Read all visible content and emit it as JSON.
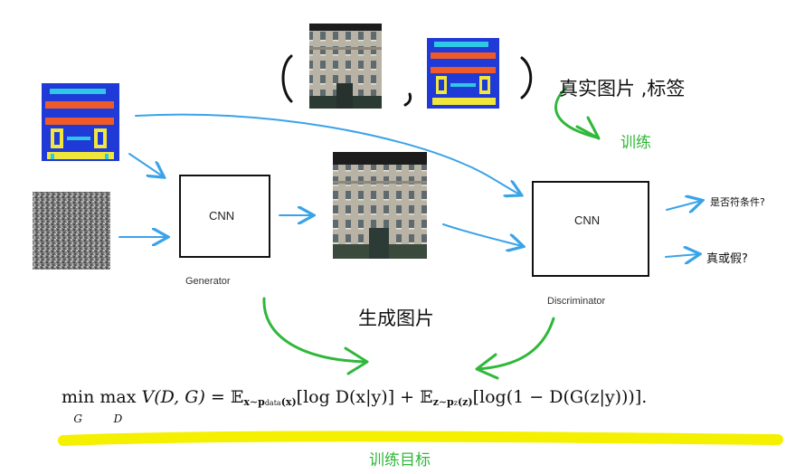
{
  "labels": {
    "generator_box": "CNN",
    "generator_caption": "Generator",
    "discriminator_box": "CNN",
    "discriminator_caption": "Discriminator",
    "generated_image_caption": "生成图片",
    "real_pair_caption": "真实图片 ,标签",
    "train_label": "训练",
    "condition_output": "是否符条件?",
    "real_fake_output": "真或假?",
    "objective_caption": "训练目标"
  },
  "formula": {
    "min": "min",
    "min_sub": "G",
    "max": "max",
    "max_sub": "D",
    "value_fn": " V(D, G) = ",
    "exp1": "𝔼",
    "exp1_sub": "x∼p",
    "exp1_sub2": "data",
    "exp1_sub3": "(x)",
    "term1": "[log D(x|y)] + ",
    "exp2": "𝔼",
    "exp2_sub": "z∼p",
    "exp2_sub2": "z",
    "exp2_sub3": "(z)",
    "term2": "[log(1 − D(G(z|y)))]."
  },
  "colors": {
    "arrow_blue": "#3aa3e8",
    "arrow_green": "#2fb83a",
    "highlight_yellow": "#f4f000",
    "label_green": "#2fb83a"
  }
}
